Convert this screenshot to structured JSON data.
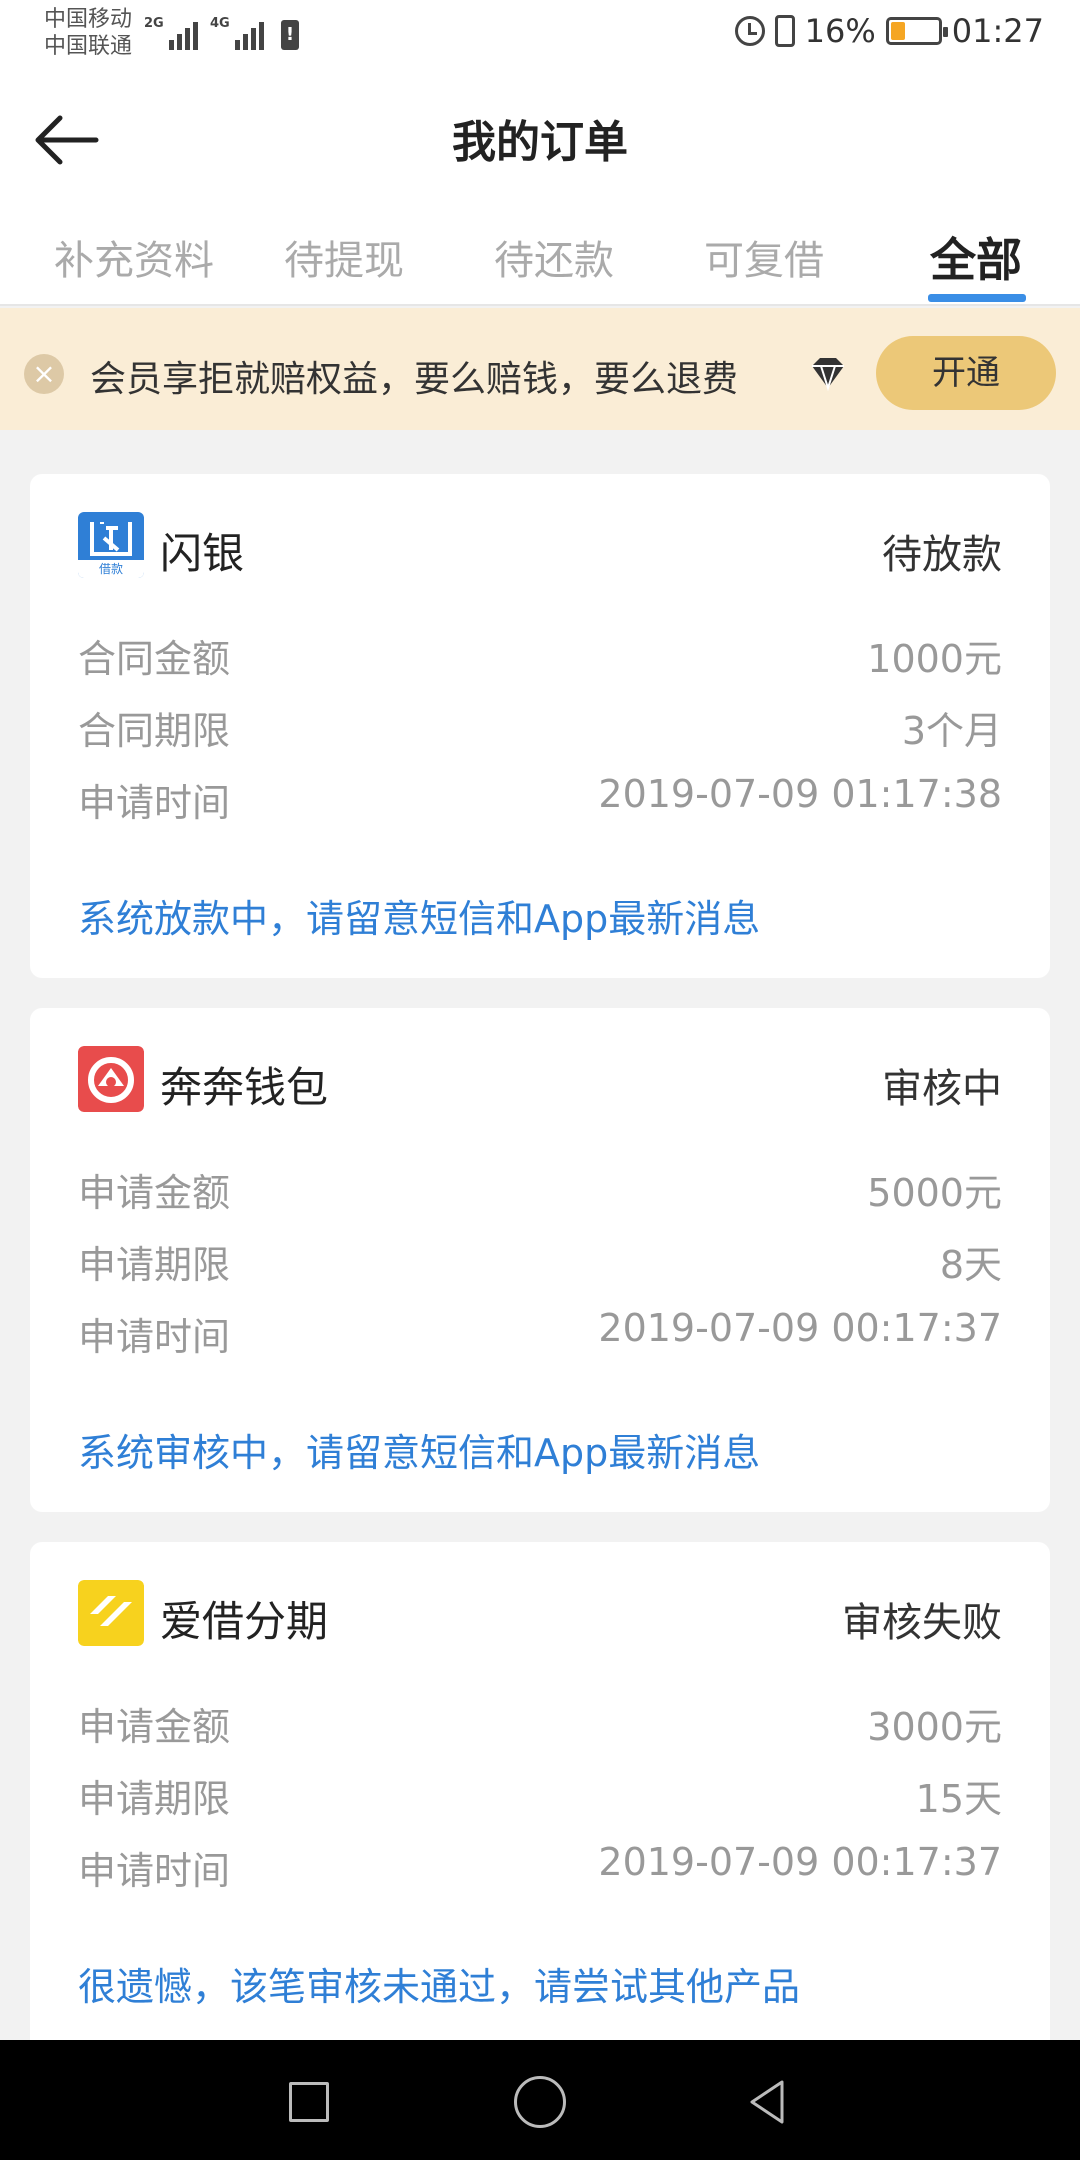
{
  "status_bar": {
    "carrier1": "中国移动",
    "carrier2": "中国联通",
    "net1": "2G",
    "net2": "4G",
    "battery": "16%",
    "time": "01:27",
    "battery_color": "#f5a623"
  },
  "header": {
    "title": "我的订单",
    "back_icon": "back-arrow-icon"
  },
  "tabs": [
    {
      "label": "补充资料",
      "active": false
    },
    {
      "label": "待提现",
      "active": false
    },
    {
      "label": "待还款",
      "active": false
    },
    {
      "label": "可复借",
      "active": false
    },
    {
      "label": "全部",
      "active": true
    }
  ],
  "promo": {
    "text": "会员享拒就赔权益，要么赔钱，要么退费",
    "button": "开通",
    "close_icon": "close-icon",
    "badge_icon": "diamond-icon"
  },
  "orders": [
    {
      "logo_text": "借款",
      "logo_color": "#2f7fd6",
      "name": "闪银",
      "status": "待放款",
      "rows": [
        {
          "label": "合同金额",
          "value": "1000元"
        },
        {
          "label": "合同期限",
          "value": "3个月"
        },
        {
          "label": "申请时间",
          "value": "2019-07-09 01:17:38"
        }
      ],
      "message": "系统放款中，请留意短信和App最新消息"
    },
    {
      "logo_color": "#e84c4c",
      "name": "奔奔钱包",
      "status": "审核中",
      "rows": [
        {
          "label": "申请金额",
          "value": "5000元"
        },
        {
          "label": "申请期限",
          "value": "8天"
        },
        {
          "label": "申请时间",
          "value": "2019-07-09 00:17:37"
        }
      ],
      "message": "系统审核中，请留意短信和App最新消息"
    },
    {
      "logo_color": "#f7d21e",
      "name": "爱借分期",
      "status": "审核失败",
      "rows": [
        {
          "label": "申请金额",
          "value": "3000元"
        },
        {
          "label": "申请期限",
          "value": "15天"
        },
        {
          "label": "申请时间",
          "value": "2019-07-09 00:17:37"
        }
      ],
      "message": "很遗憾，该笔审核未通过，请尝试其他产品"
    }
  ],
  "nav_bar": {
    "icons": [
      "recent-apps-icon",
      "home-icon",
      "back-icon"
    ]
  }
}
